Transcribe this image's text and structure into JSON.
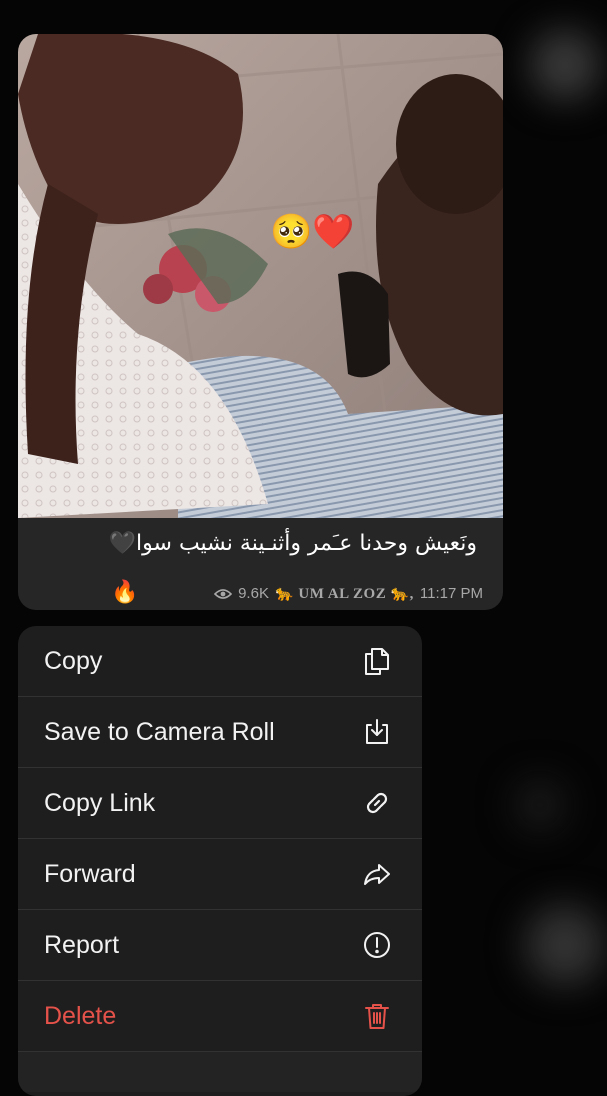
{
  "message": {
    "caption": "ونَعيش وحدنا عـَمر وأثنـينة نشيب سوا🖤",
    "trailing_emoji": "🔥",
    "views": "9.6K",
    "author": "🐆 UM AL ZOZ 🐆,",
    "time": "11:17 PM",
    "photo_overlay_emoji": "🥺❤️"
  },
  "menu": {
    "items": [
      {
        "label": "Copy",
        "icon": "copy-icon"
      },
      {
        "label": "Save to Camera Roll",
        "icon": "save-download-icon"
      },
      {
        "label": "Copy Link",
        "icon": "link-icon"
      },
      {
        "label": "Forward",
        "icon": "forward-arrow-icon"
      },
      {
        "label": "Report",
        "icon": "report-exclamation-icon"
      },
      {
        "label": "Delete",
        "icon": "trash-icon",
        "color": "#e5524a"
      }
    ]
  },
  "colors": {
    "background": "#050505",
    "bubble": "#262626",
    "menu": "#1e1e1e",
    "danger": "#e5524a",
    "meta_text": "#a8a8a8"
  }
}
